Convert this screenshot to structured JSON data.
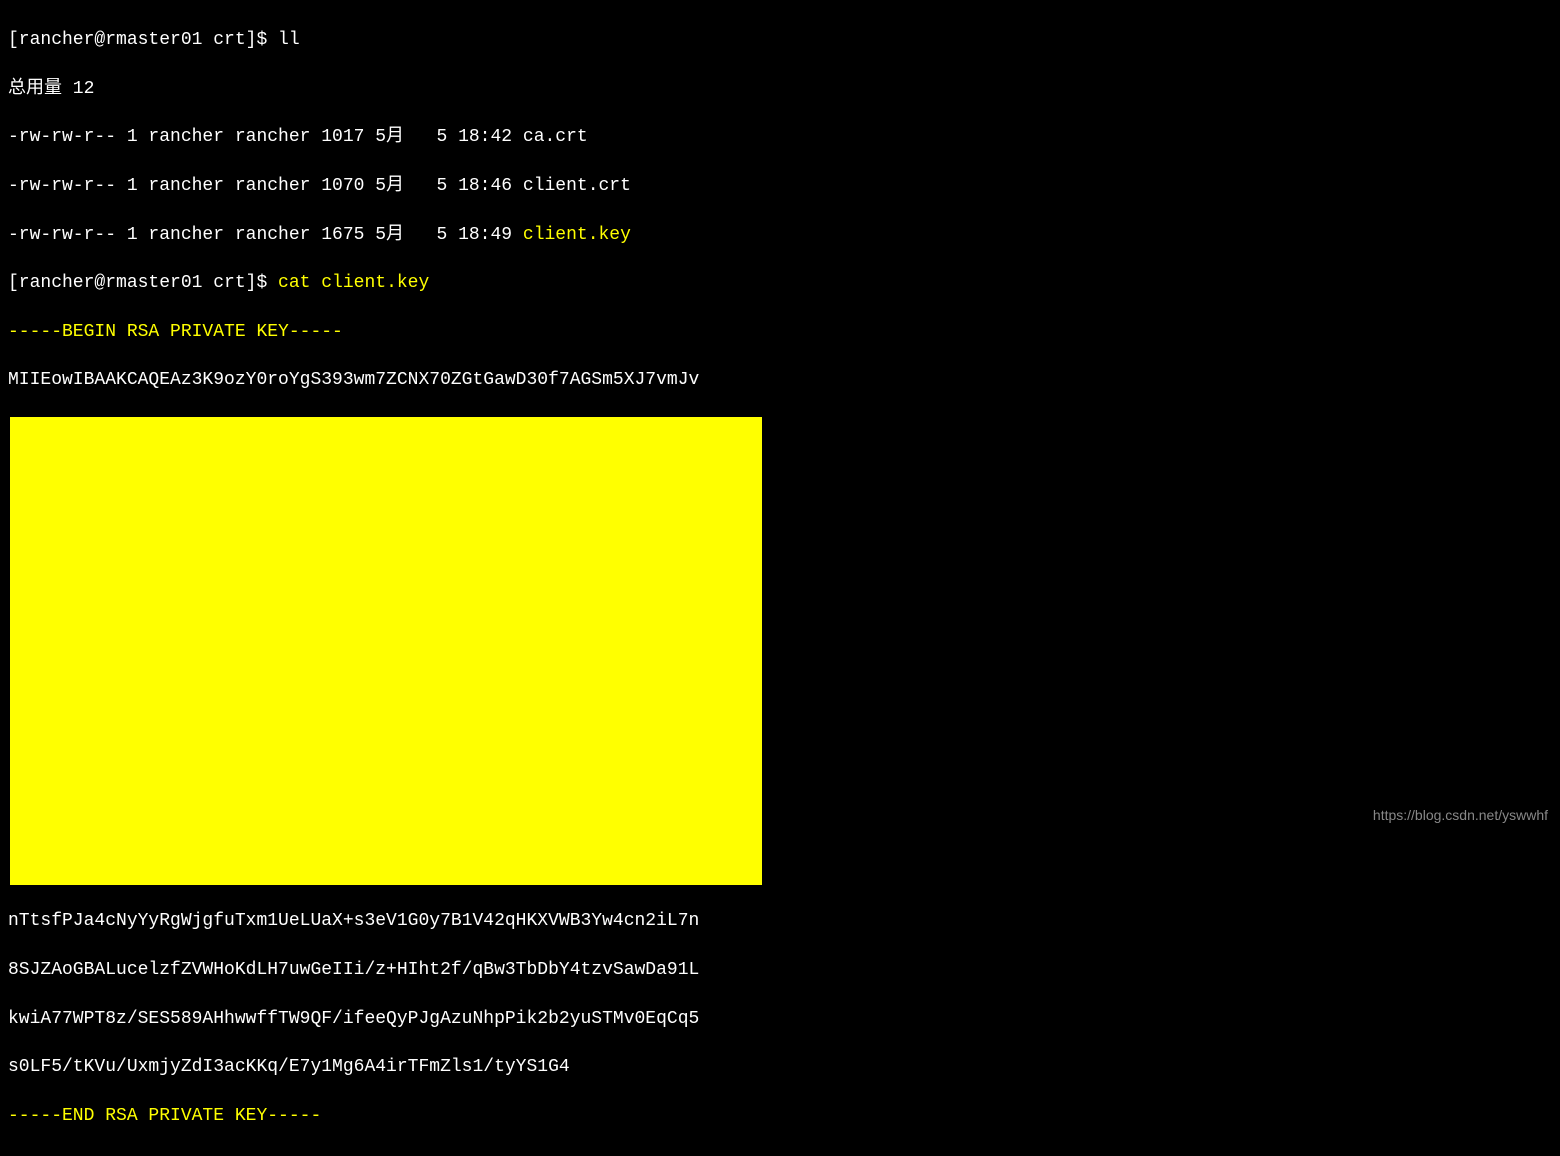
{
  "terminal": {
    "prompt1": "[rancher@rmaster01 crt]$ ",
    "command1": "ll",
    "total_line": "总用量 12",
    "file1_perms": "-rw-rw-r-- 1 rancher rancher 1017 5月   5 18:42 ",
    "file1_name": "ca.crt",
    "file2_perms": "-rw-rw-r-- 1 rancher rancher 1070 5月   5 18:46 ",
    "file2_name": "client.crt",
    "file3_perms": "-rw-rw-r-- 1 rancher rancher 1675 5月   5 18:49 ",
    "file3_name": "client.key",
    "prompt2": "[rancher@rmaster01 crt]$ ",
    "command2": "cat client.key",
    "key_begin": "-----BEGIN RSA PRIVATE KEY-----",
    "key_line1": "MIIEowIBAAKCAQEAz3K9ozY0roYgS393wm7ZCNX70ZGtGawD30f7AGSm5XJ7vmJv",
    "key_line_tail1": "nTtsfPJa4cNyYyRgWjgfuTxm1UeLUaX+s3eV1G0y7B1V42qHKXVWB3Yw4cn2iL7n",
    "key_line_tail2": "8SJZAoGBALucelzfZVWHoKdLH7uwGeIIi/z+HIht2f/qBw3TbDbY4tzvSawDa91L",
    "key_line_tail3": "kwiA77WPT8z/SES589AHhwwffTW9QF/ifeeQyPJgAzuNhpPik2b2yuSTMv0EqCq5",
    "key_line_tail4": "s0LF5/tKVu/UxmjyZdI3acKKq/E7y1Mg6A4irTFmZls1/tyYS1G4",
    "key_end": "-----END RSA PRIVATE KEY-----"
  },
  "watermark": "https://blog.csdn.net/yswwhf"
}
